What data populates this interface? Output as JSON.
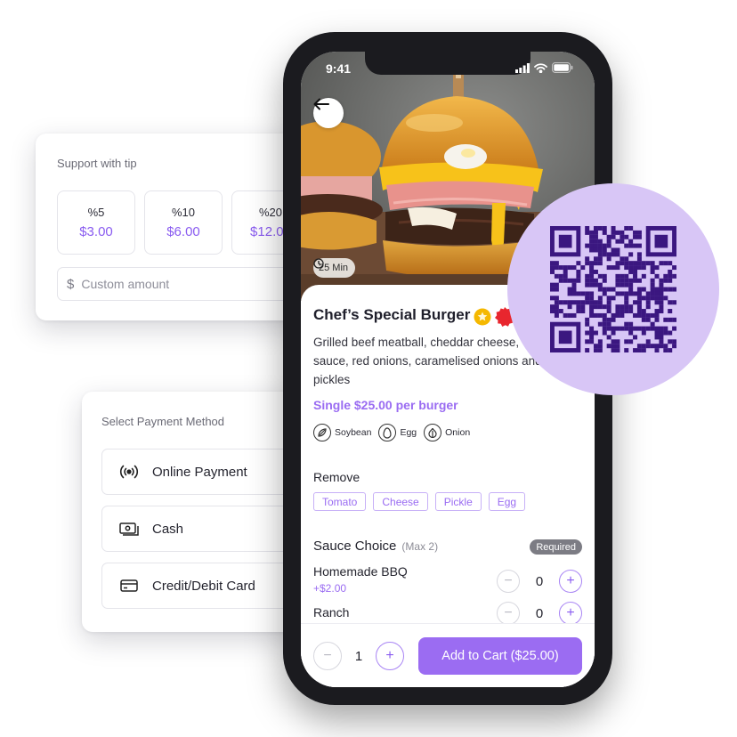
{
  "tip_card": {
    "title": "Support with tip",
    "options": [
      {
        "percent": "%5",
        "amount": "$3.00"
      },
      {
        "percent": "%10",
        "amount": "$6.00"
      },
      {
        "percent": "%20",
        "amount": "$12.00"
      }
    ],
    "custom_placeholder": "Custom amount",
    "currency_symbol": "$"
  },
  "payment_card": {
    "title": "Select Payment Method",
    "options": [
      {
        "label": "Online Payment",
        "icon": "wireless-icon"
      },
      {
        "label": "Cash",
        "icon": "banknote-icon"
      },
      {
        "label": "Credit/Debit Card",
        "icon": "card-icon"
      }
    ]
  },
  "phone": {
    "status_time": "9:41",
    "prep_time": "25 Min",
    "dish": {
      "title": "Chef’s Special Burger",
      "description": "Grilled beef meatball, cheddar cheese, sauce, red onions, caramelised onions and pickles",
      "price_line": "Single $25.00 per burger",
      "allergens": [
        {
          "label": "Soybean",
          "icon": "soybean-icon"
        },
        {
          "label": "Egg",
          "icon": "egg-icon"
        },
        {
          "label": "Onion",
          "icon": "onion-icon"
        }
      ]
    },
    "remove": {
      "title": "Remove",
      "items": [
        "Tomato",
        "Cheese",
        "Pickle",
        "Egg"
      ]
    },
    "sauce": {
      "title": "Sauce Choice",
      "max": "(Max 2)",
      "required_label": "Required",
      "options": [
        {
          "name": "Homemade BBQ",
          "price": "+$2.00",
          "qty": "0"
        },
        {
          "name": "Ranch",
          "price": "",
          "qty": "0"
        }
      ]
    },
    "cart": {
      "quantity": "1",
      "button_label": "Add to Cart ($25.00)"
    }
  },
  "colors": {
    "accent": "#9b6cf2",
    "qr_background": "#d8c6f6",
    "qr_modules": "#3b1780"
  }
}
